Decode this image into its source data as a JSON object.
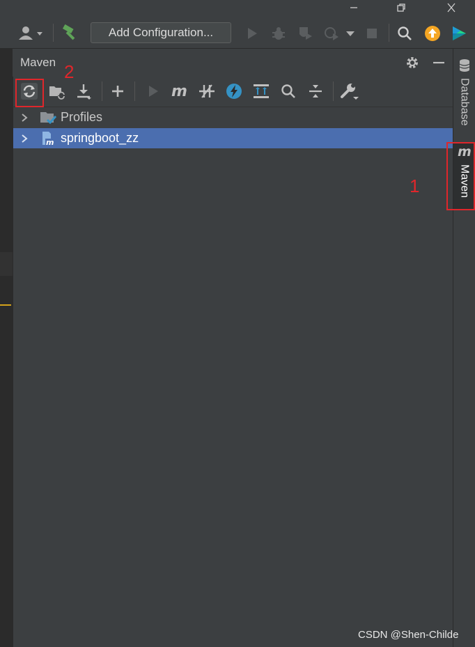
{
  "window": {
    "controls": [
      "minimize-icon",
      "restore-icon",
      "close-icon"
    ]
  },
  "toolbar": {
    "add_configuration_label": "Add Configuration...",
    "icons": [
      "user-icon",
      "build-hammer-icon",
      "run-icon",
      "debug-icon",
      "coverage-icon",
      "profile-icon",
      "stop-icon",
      "search-icon",
      "update-icon",
      "toolbox-icon"
    ]
  },
  "maven": {
    "title": "Maven",
    "toolbar_icons": [
      "reload-icon",
      "generate-sources-icon",
      "download-icon",
      "add-icon",
      "run-icon",
      "maven-goal-icon",
      "toggle-offline-icon",
      "skip-tests-icon",
      "show-dependencies-icon",
      "find-icon",
      "collapse-all-icon",
      "settings-wrench-icon"
    ],
    "tree": [
      {
        "label": "Profiles",
        "icon": "profiles-folder-icon",
        "selected": false
      },
      {
        "label": "springboot_zz",
        "icon": "maven-project-icon",
        "selected": true
      }
    ]
  },
  "right_sidebar": {
    "tabs": [
      {
        "label": "Database",
        "icon": "database-icon"
      },
      {
        "label": "Maven",
        "icon": "maven-m-icon"
      }
    ]
  },
  "annotations": {
    "marker_1": "1",
    "marker_2": "2"
  },
  "watermark": "CSDN @Shen-Childe",
  "colors": {
    "selection": "#4b6eaf",
    "annotation_red": "#e0262b",
    "accent_orange": "#f5a623"
  }
}
